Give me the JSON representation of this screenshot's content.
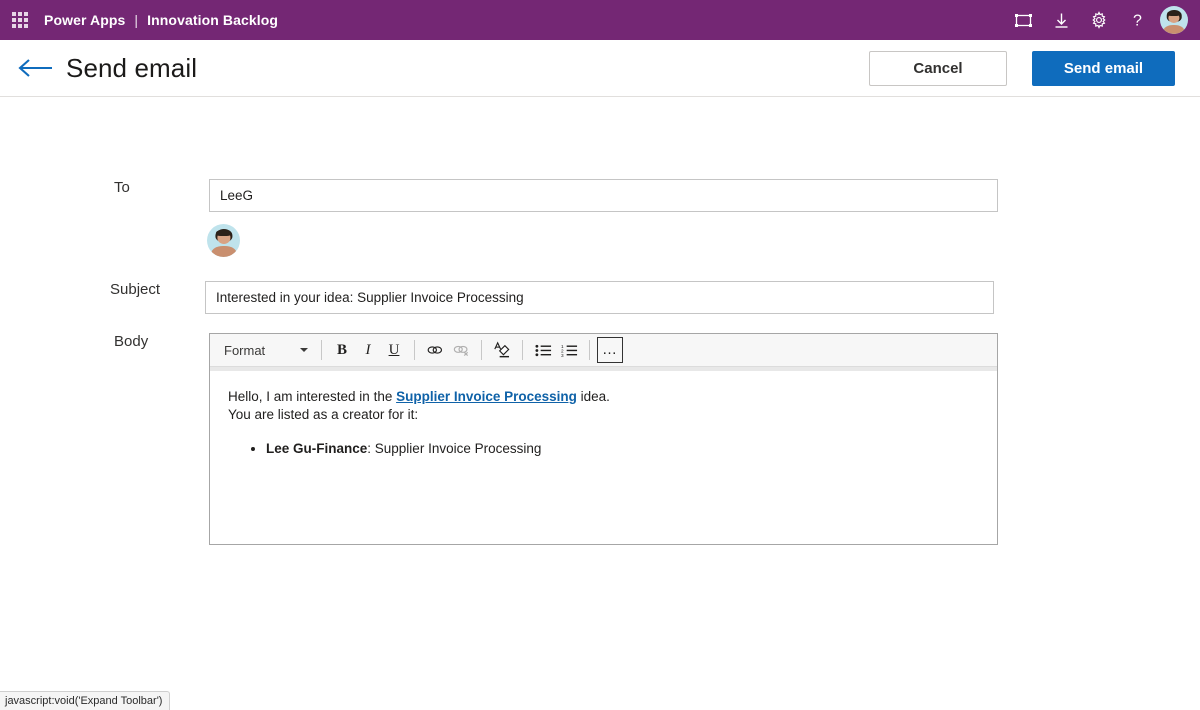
{
  "suite": {
    "waffle_icon": "app-launcher-waffle-icon",
    "brand": "Power Apps",
    "separator": "|",
    "app_name": "Innovation Backlog",
    "icons": [
      {
        "name": "fit-to-screen-icon",
        "glyph": "fit-screen"
      },
      {
        "name": "download-icon",
        "glyph": "download"
      },
      {
        "name": "settings-gear-icon",
        "glyph": "gear"
      },
      {
        "name": "help-question-icon",
        "glyph": "question"
      }
    ],
    "avatar_alt": "user-avatar"
  },
  "command_bar": {
    "back_icon": "back-arrow-icon",
    "title": "Send email",
    "cancel_label": "Cancel",
    "send_label": "Send email"
  },
  "form": {
    "to": {
      "label": "To",
      "value": "LeeG",
      "placeholder": "",
      "recipient_avatar": "recipient-avatar"
    },
    "subject": {
      "label": "Subject",
      "value": "Interested in your idea: Supplier Invoice Processing",
      "placeholder": ""
    },
    "body": {
      "label": "Body",
      "toolbar": {
        "format_label": "Format",
        "bold": "B",
        "italic": "I",
        "underline": "U",
        "more": "…"
      },
      "content": {
        "line1_prefix": "Hello, I am interested in the ",
        "link_text": "Supplier Invoice Processing",
        "line1_suffix": " idea.",
        "line2": "You are listed as a creator for it:",
        "list_items": [
          {
            "bold": "Lee Gu-Finance",
            "rest": ": Supplier Invoice Processing"
          }
        ]
      }
    }
  },
  "status_bar": {
    "text": "javascript:void('Expand Toolbar')"
  },
  "colors": {
    "suite_purple": "#742774",
    "primary_blue": "#0f6cbd",
    "link_blue": "#0f62a8",
    "back_arrow_blue": "#0f6cbd"
  }
}
